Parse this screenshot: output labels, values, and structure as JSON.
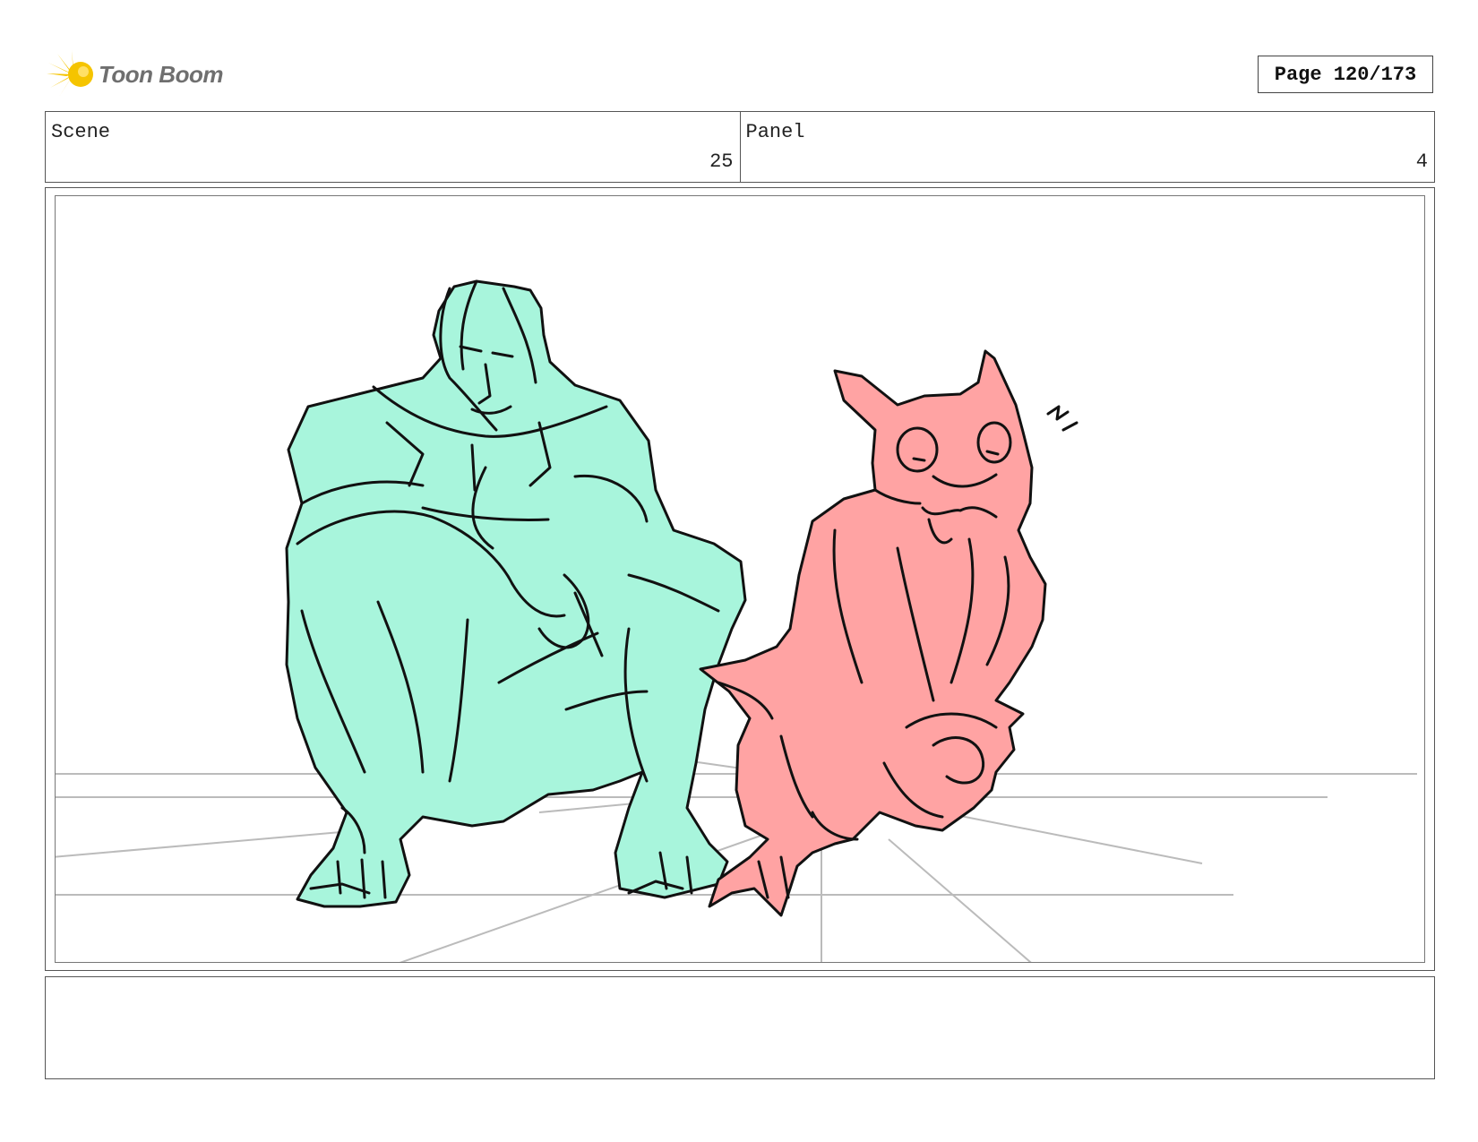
{
  "brand": {
    "name": "Toon Boom",
    "logo_icon": "starburst-logo-icon",
    "accent": "#f5c400"
  },
  "page": {
    "label": "Page 120/173"
  },
  "scene": {
    "label": "Scene",
    "value": "25"
  },
  "panel": {
    "label": "Panel",
    "value": "4"
  },
  "drawing": {
    "characters": [
      {
        "name": "crouching-man",
        "fill": "#a8f5dc"
      },
      {
        "name": "pink-creature",
        "fill": "#ffa3a3"
      }
    ],
    "line_color": "#111111",
    "guide_color": "#bbbbbb"
  },
  "notes": {
    "text": ""
  }
}
